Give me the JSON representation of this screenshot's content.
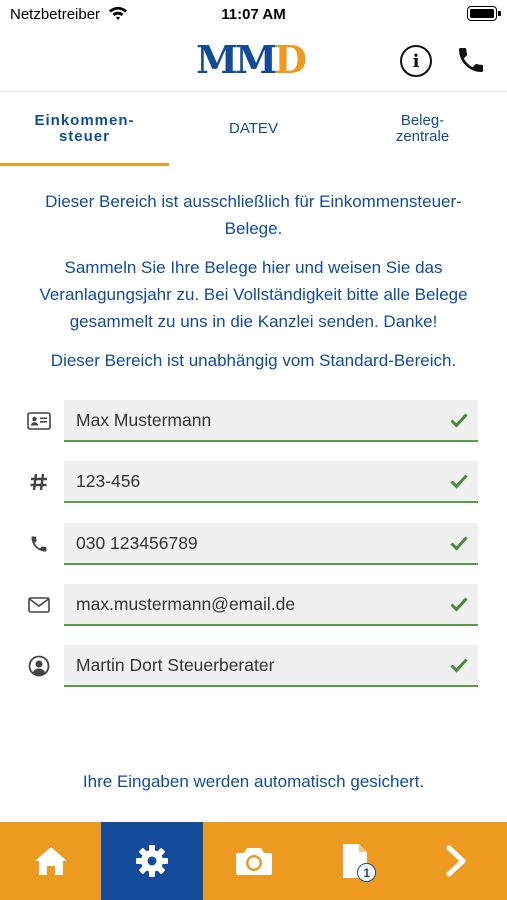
{
  "status_bar": {
    "carrier": "Netzbetreiber",
    "time": "11:07 AM",
    "icons": [
      "wifi-icon",
      "battery-icon"
    ]
  },
  "header": {
    "logo_text_primary": "MM",
    "logo_text_accent": "D",
    "info_label": "i",
    "icons": [
      "info-icon",
      "phone-icon"
    ]
  },
  "tabs": [
    {
      "label": "Einkommen-\nsteuer",
      "active": true
    },
    {
      "label": "DATEV",
      "active": false
    },
    {
      "label": "Beleg-\nzentrale",
      "active": false
    }
  ],
  "content": {
    "paragraph_1": "Dieser Bereich ist ausschließlich für Einkommensteuer-Belege.",
    "paragraph_2": "Sammeln Sie Ihre Belege hier und weisen Sie das Veranlagungsjahr zu. Bei Vollständigkeit bitte alle Belege gesammelt zu uns in die Kanzlei senden. Danke!",
    "paragraph_3": "Dieser Bereich ist unabhängig vom Standard-Bereich."
  },
  "fields": [
    {
      "icon": "id-card-icon",
      "value": "Max Mustermann",
      "valid": true
    },
    {
      "icon": "hash-icon",
      "value": "123-456",
      "valid": true
    },
    {
      "icon": "phone-icon",
      "value": "030 123456789",
      "valid": true
    },
    {
      "icon": "envelope-icon",
      "value": "max.mustermann@email.de",
      "valid": true
    },
    {
      "icon": "user-circle-icon",
      "value": "Martin Dort Steuerberater",
      "valid": true
    }
  ],
  "autosave_note": "Ihre Eingaben werden automatisch gesichert.",
  "bottom_nav": {
    "items": [
      "home-icon",
      "gear-icon",
      "camera-icon",
      "document-icon",
      "chevron-right-icon"
    ],
    "active_index": 1,
    "document_badge": "1"
  },
  "colors": {
    "brand_blue": "#134b9b",
    "brand_orange": "#ec9a20",
    "valid_green": "#5b9a49",
    "field_bg": "#f0f0f0"
  }
}
